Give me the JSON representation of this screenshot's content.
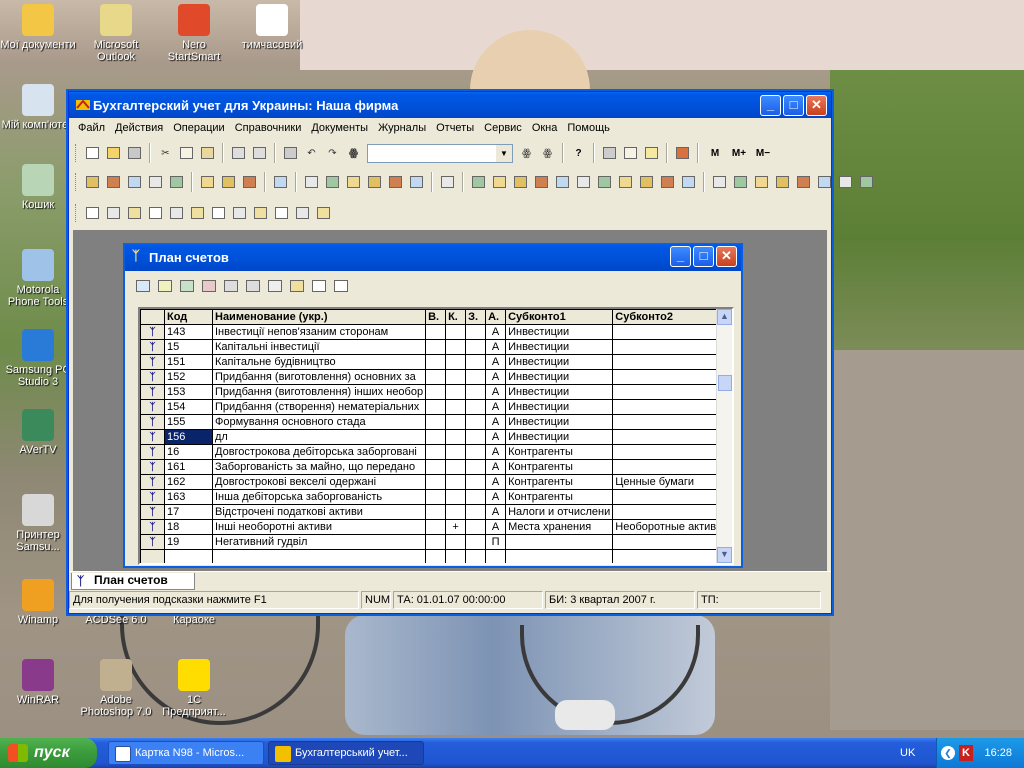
{
  "desktop": {
    "icons": [
      {
        "label": "Мої документи",
        "color": "#f3c645"
      },
      {
        "label": "Microsoft Outlook",
        "color": "#e8d98a"
      },
      {
        "label": "Nero StartSmart",
        "color": "#e04a2a"
      },
      {
        "label": "тимчасовий",
        "color": "#ffffff"
      },
      {
        "label": "Мій комп'ютер",
        "color": "#d7e3ef"
      },
      {
        "label": "Кошик",
        "color": "#b8d6b6"
      },
      {
        "label": "Motorola Phone Tools",
        "color": "#9fc3e8"
      },
      {
        "label": "Samsung PC Studio 3",
        "color": "#2a7ad8"
      },
      {
        "label": "AVerTV",
        "color": "#3a8a5c"
      },
      {
        "label": "Принтер Samsu...",
        "color": "#d8d8d8"
      },
      {
        "label": "Winamp",
        "color": "#f0a020"
      },
      {
        "label": "ACDSee 6.0",
        "color": "#8a8a8a"
      },
      {
        "label": "Караоке",
        "color": "#8a8a8a"
      },
      {
        "label": "WinRAR",
        "color": "#8a3a8a"
      },
      {
        "label": "Adobe Photoshop 7.0",
        "color": "#c0b090"
      },
      {
        "label": "1С Предприят...",
        "color": "#ffdd00"
      }
    ]
  },
  "main_window": {
    "title": "Бухгалтерский учет для Украины: Наша фирма",
    "menu": [
      "Файл",
      "Действия",
      "Операции",
      "Справочники",
      "Документы",
      "Журналы",
      "Отчеты",
      "Сервис",
      "Окна",
      "Помощь"
    ],
    "toolbar_text_buttons": [
      "M",
      "M+",
      "M−"
    ],
    "search_value": "",
    "doc_tab": "План счетов",
    "status": {
      "hint": "Для получения подсказки нажмите F1",
      "num": "NUM",
      "ta": "ТА: 01.01.07  00:00:00",
      "bi": "БИ: 3 квартал 2007 г.",
      "tp": "ТП:"
    }
  },
  "child_window": {
    "title": "План счетов",
    "columns": [
      "",
      "Код",
      "Наименование (укр.)",
      "В.",
      "К.",
      "З.",
      "А.",
      "Субконто1",
      "Субконто2"
    ],
    "rows": [
      {
        "mark": "ᛉ",
        "code": "143",
        "name": "Інвестиції непов'язаним сторонам",
        "v": "",
        "k": "",
        "z": "",
        "a": "А",
        "s1": "Инвестиции",
        "s2": ""
      },
      {
        "mark": "ᛉ",
        "code": "15",
        "name": "Капітальні інвестиції",
        "v": "",
        "k": "",
        "z": "",
        "a": "А",
        "s1": "Инвестиции",
        "s2": ""
      },
      {
        "mark": "ᛉ",
        "code": "151",
        "name": "Капітальне будівництво",
        "v": "",
        "k": "",
        "z": "",
        "a": "А",
        "s1": "Инвестиции",
        "s2": ""
      },
      {
        "mark": "ᛉ",
        "code": "152",
        "name": "Придбання (виготовлення) основних за",
        "v": "",
        "k": "",
        "z": "",
        "a": "А",
        "s1": "Инвестиции",
        "s2": ""
      },
      {
        "mark": "ᛉ",
        "code": "153",
        "name": "Придбання (виготовлення) інших необор",
        "v": "",
        "k": "",
        "z": "",
        "a": "А",
        "s1": "Инвестиции",
        "s2": ""
      },
      {
        "mark": "ᛉ",
        "code": "154",
        "name": "Придбання (створення) нематеріальних",
        "v": "",
        "k": "",
        "z": "",
        "a": "А",
        "s1": "Инвестиции",
        "s2": ""
      },
      {
        "mark": "ᛉ",
        "code": "155",
        "name": "Формування основного стада",
        "v": "",
        "k": "",
        "z": "",
        "a": "А",
        "s1": "Инвестиции",
        "s2": ""
      },
      {
        "mark": "ᛉ",
        "code": "156",
        "name": "дл",
        "v": "",
        "k": "",
        "z": "",
        "a": "А",
        "s1": "Инвестиции",
        "s2": "",
        "selected": true
      },
      {
        "mark": "ᛉ",
        "code": "16",
        "name": "Довгострокова дебіторська заборговані",
        "v": "",
        "k": "",
        "z": "",
        "a": "А",
        "s1": "Контрагенты",
        "s2": ""
      },
      {
        "mark": "ᛉ",
        "code": "161",
        "name": "Заборгованість за майно, що передано",
        "v": "",
        "k": "",
        "z": "",
        "a": "А",
        "s1": "Контрагенты",
        "s2": ""
      },
      {
        "mark": "ᛉ",
        "code": "162",
        "name": "Довгострокові векселі одержані",
        "v": "",
        "k": "",
        "z": "",
        "a": "А",
        "s1": "Контрагенты",
        "s2": "Ценные бумаги"
      },
      {
        "mark": "ᛉ",
        "code": "163",
        "name": "Інша дебіторська заборгованість",
        "v": "",
        "k": "",
        "z": "",
        "a": "А",
        "s1": "Контрагенты",
        "s2": ""
      },
      {
        "mark": "ᛉ",
        "code": "17",
        "name": "Відстрочені податкові активи",
        "v": "",
        "k": "",
        "z": "",
        "a": "А",
        "s1": "Налоги и отчислени",
        "s2": ""
      },
      {
        "mark": "ᛉ",
        "code": "18",
        "name": "Інші необоротні активи",
        "v": "",
        "k": "+",
        "z": "",
        "a": "А",
        "s1": "Места хранения",
        "s2": "Необоротные актив"
      },
      {
        "mark": "ᛉ",
        "code": "19",
        "name": "Негативний гудвіл",
        "v": "",
        "k": "",
        "z": "",
        "a": "П",
        "s1": "",
        "s2": ""
      }
    ]
  },
  "taskbar": {
    "start": "пуск",
    "tasks": [
      "Картка N98 - Micros...",
      "Бухгалтерський учет..."
    ],
    "lang": "UK",
    "clock": "16:28"
  }
}
